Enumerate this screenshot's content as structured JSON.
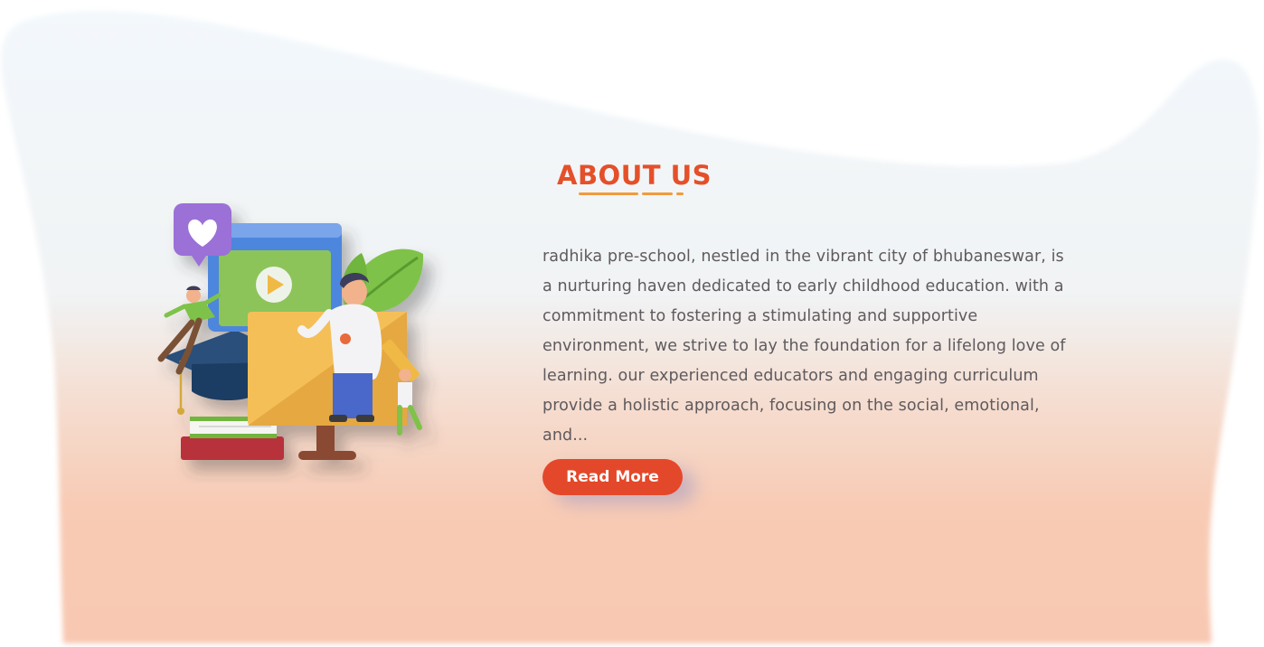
{
  "about": {
    "title": "ABOUT US",
    "description": "radhika pre-school, nestled in the vibrant city of bhubaneswar, is a nurturing haven dedicated to early childhood education. with a commitment to fostering a stimulating and supportive environment, we strive to lay the foundation for a lifelong love of learning. our experienced educators and engaging curriculum provide a holistic approach, focusing on the social, emotional, and...",
    "button_label": "Read More"
  },
  "colors": {
    "accent": "#e4502a",
    "button": "#e4482a",
    "underline": "#f29a3c",
    "text": "#5e5a5e",
    "bg_top": "#f3f8fc",
    "bg_bottom": "#f8c8b2"
  },
  "illustration": {
    "icons": [
      "heart-icon",
      "play-icon",
      "graduation-cap-icon",
      "books-icon",
      "pencil-icon",
      "leaf-icon",
      "monitor-icon"
    ]
  }
}
